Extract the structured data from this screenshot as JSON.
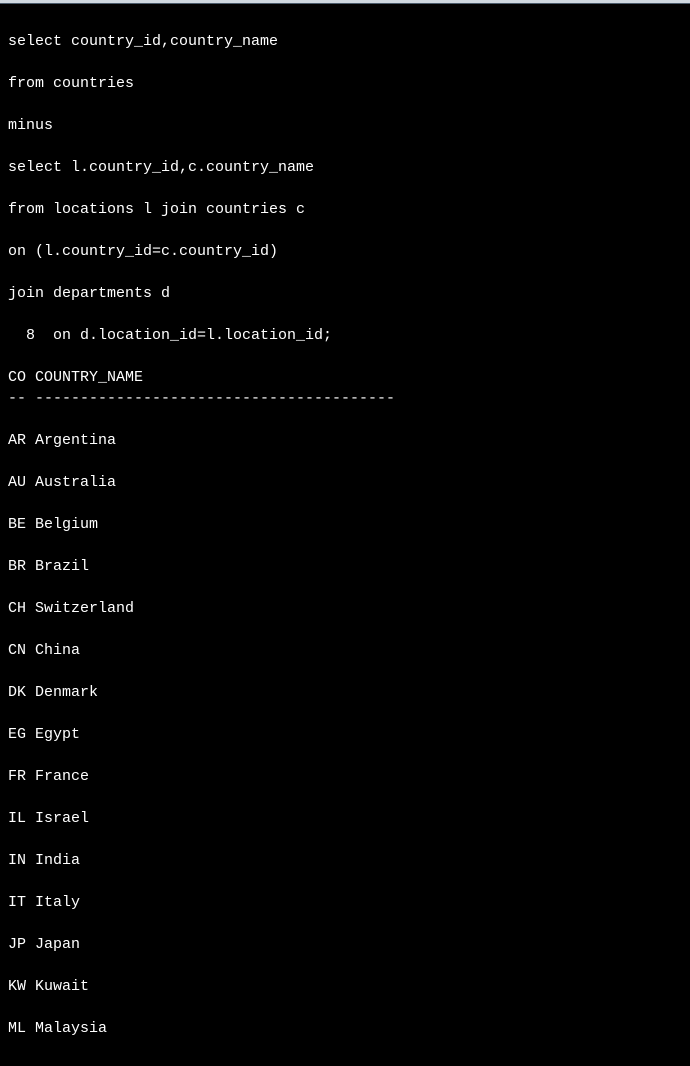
{
  "query": {
    "lines": [
      "select country_id,country_name",
      "from countries",
      "minus",
      "select l.country_id,c.country_name",
      "from locations l join countries c",
      "on (l.country_id=c.country_id)",
      "join departments d",
      "  8  on d.location_id=l.location_id;"
    ]
  },
  "result": {
    "header": "CO COUNTRY_NAME",
    "separator": "-- ----------------------------------------",
    "rows": [
      "AR Argentina",
      "AU Australia",
      "BE Belgium",
      "BR Brazil",
      "CH Switzerland",
      "CN China",
      "DK Denmark",
      "EG Egypt",
      "FR France",
      "IL Israel",
      "IN India",
      "IT Italy",
      "JP Japan",
      "KW Kuwait",
      "ML Malaysia"
    ]
  }
}
